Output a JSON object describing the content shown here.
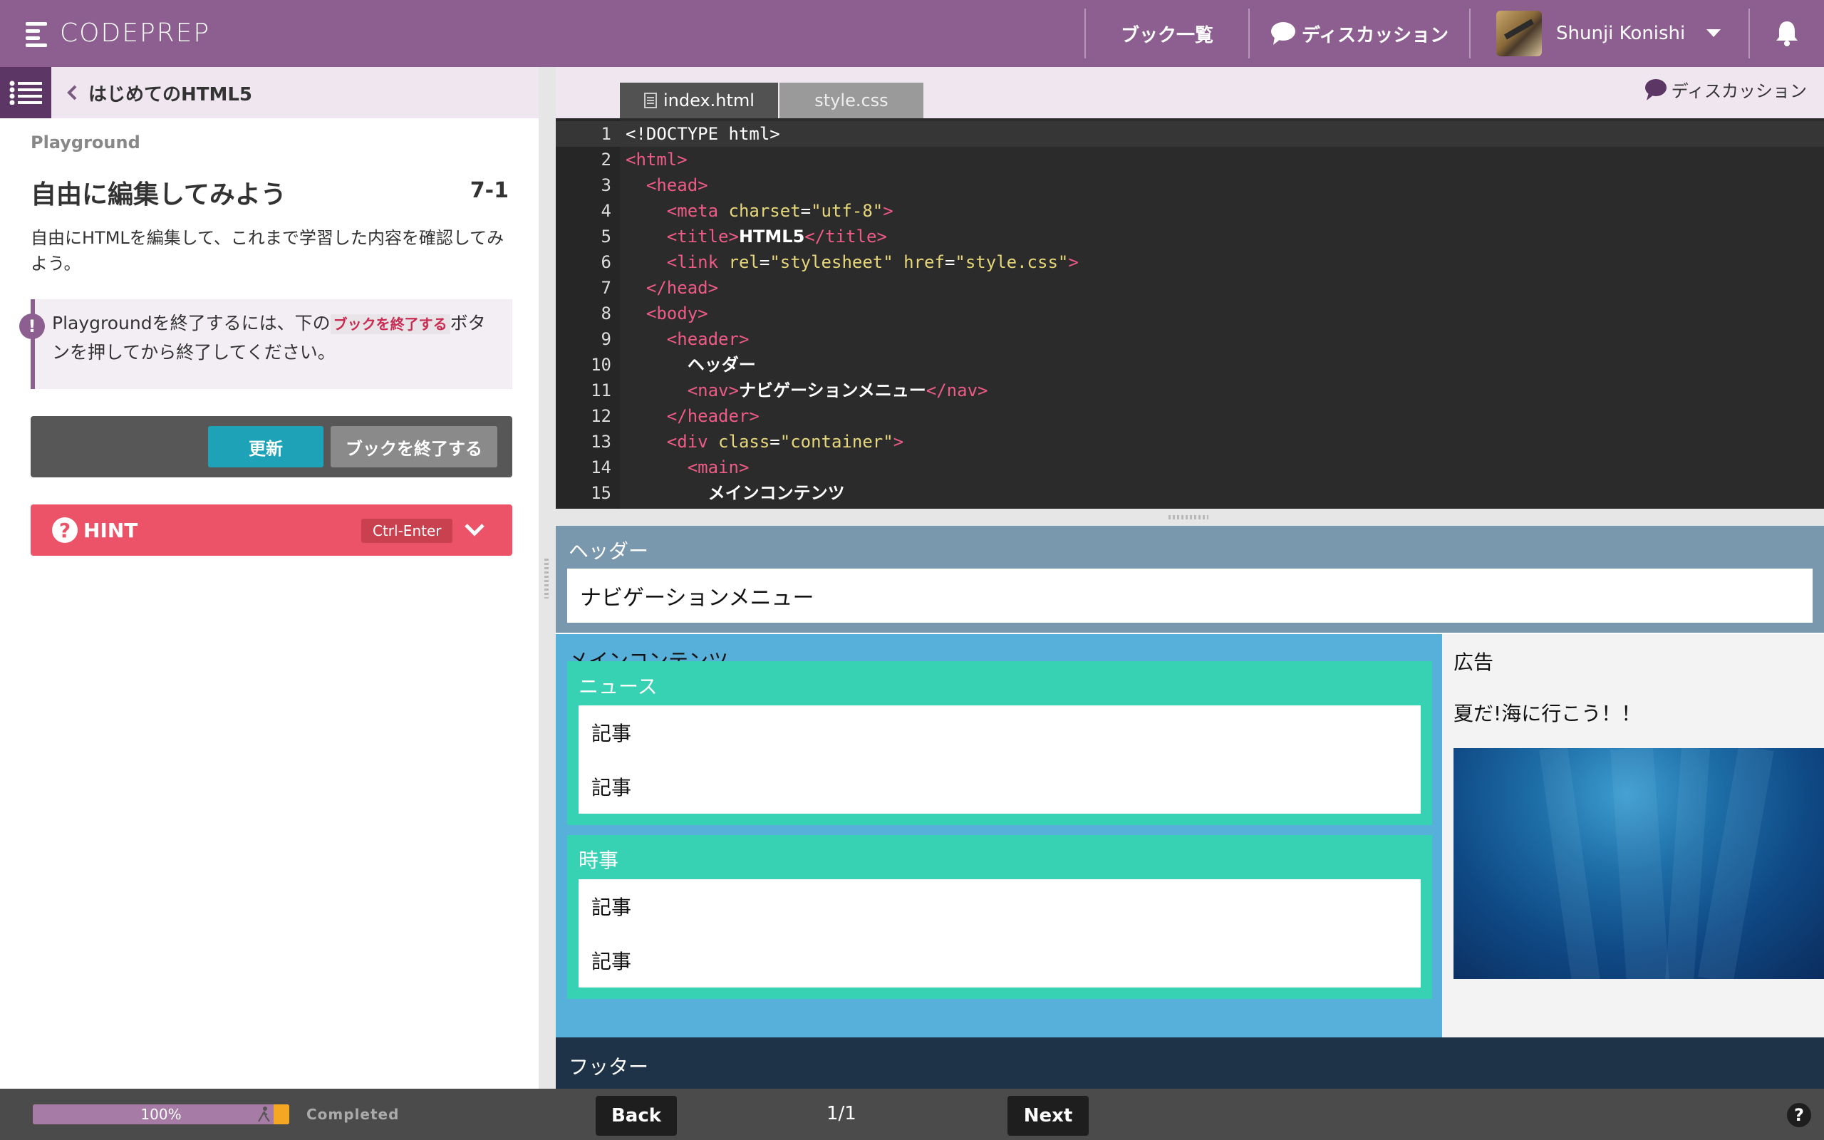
{
  "topbar": {
    "logo_text": "CODEPREP",
    "books_label": "ブック一覧",
    "discussion_label": "ディスカッション",
    "user_name": "Shunji Konishi",
    "accent_color": "#8d5f91"
  },
  "sidebar": {
    "breadcrumb": "はじめてのHTML5",
    "section_label": "Playground",
    "title": "自由に編集してみよう",
    "lesson_number": "7-1",
    "description": "自由にHTMLを編集して、これまで学習した内容を確認してみよう。",
    "notice": {
      "prefix": "Playgroundを終了するには、下の",
      "code": "ブックを終了する",
      "suffix": "ボタンを押してから終了してください。"
    },
    "update_button": "更新",
    "finish_button": "ブックを終了する",
    "hint_label": "HINT",
    "hint_shortcut": "Ctrl-Enter"
  },
  "editor": {
    "tabs": [
      {
        "label": "index.html",
        "active": true
      },
      {
        "label": "style.css",
        "active": false
      }
    ],
    "discussion_label": "ディスカッション",
    "lines": [
      {
        "n": "1",
        "html": "<span style=\"color:#fff\">&lt;!DOCTYPE html&gt;</span>"
      },
      {
        "n": "2",
        "html": "<span class=\"t\">&lt;html&gt;</span>"
      },
      {
        "n": "3",
        "html": "  <span class=\"t\">&lt;head&gt;</span>"
      },
      {
        "n": "4",
        "html": "    <span class=\"t\">&lt;meta</span> <span class=\"a\">charset</span>=<span class=\"s\">\"utf-8\"</span><span class=\"t\">&gt;</span>"
      },
      {
        "n": "5",
        "html": "    <span class=\"t\">&lt;title&gt;</span><span class=\"w\">HTML5</span><span class=\"t\">&lt;/title&gt;</span>"
      },
      {
        "n": "6",
        "html": "    <span class=\"t\">&lt;link</span> <span class=\"a\">rel</span>=<span class=\"s\">\"stylesheet\"</span> <span class=\"a\">href</span>=<span class=\"s\">\"style.css\"</span><span class=\"t\">&gt;</span>"
      },
      {
        "n": "7",
        "html": "  <span class=\"t\">&lt;/head&gt;</span>"
      },
      {
        "n": "8",
        "html": "  <span class=\"t\">&lt;body&gt;</span>"
      },
      {
        "n": "9",
        "html": "    <span class=\"t\">&lt;header&gt;</span>"
      },
      {
        "n": "10",
        "html": "      <span class=\"w\">ヘッダー</span>"
      },
      {
        "n": "11",
        "html": "      <span class=\"t\">&lt;nav&gt;</span><span class=\"w\">ナビゲーションメニュー</span><span class=\"t\">&lt;/nav&gt;</span>"
      },
      {
        "n": "12",
        "html": "    <span class=\"t\">&lt;/header&gt;</span>"
      },
      {
        "n": "13",
        "html": "    <span class=\"t\">&lt;div</span> <span class=\"a\">class</span>=<span class=\"s\">\"container\"</span><span class=\"t\">&gt;</span>"
      },
      {
        "n": "14",
        "html": "      <span class=\"t\">&lt;main&gt;</span>"
      },
      {
        "n": "15",
        "html": "        <span class=\"w\">メインコンテンツ</span>"
      }
    ]
  },
  "preview": {
    "header_label": "ヘッダー",
    "nav_label": "ナビゲーションメニュー",
    "main_label": "メインコンテンツ",
    "sections": [
      {
        "title": "ニュース",
        "articles": [
          "記事",
          "記事"
        ]
      },
      {
        "title": "時事",
        "articles": [
          "記事",
          "記事"
        ]
      }
    ],
    "aside_label": "広告",
    "aside_text": "夏だ!海に行こう！！",
    "footer_label": "フッター"
  },
  "bottombar": {
    "progress_percent": "100%",
    "progress_value": 1.0,
    "completed_label": "Completed",
    "back_label": "Back",
    "page_indicator": "1/1",
    "next_label": "Next",
    "help_label": "?"
  }
}
